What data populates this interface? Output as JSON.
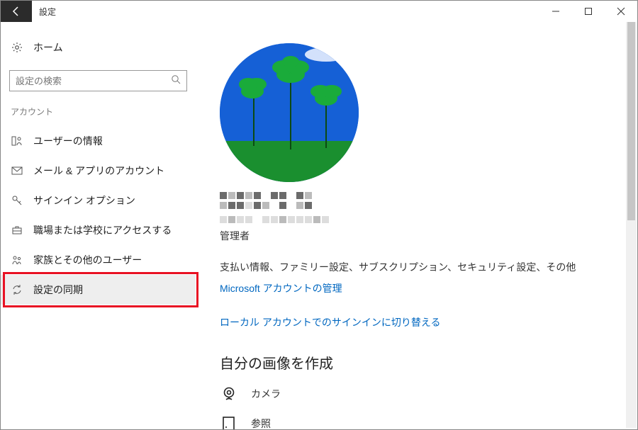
{
  "titlebar": {
    "title": "設定"
  },
  "sidebar": {
    "home": "ホーム",
    "search_placeholder": "設定の検索",
    "section": "アカウント",
    "items": [
      {
        "label": "ユーザーの情報",
        "icon": "person"
      },
      {
        "label": "メール & アプリのアカウント",
        "icon": "mail"
      },
      {
        "label": "サインイン オプション",
        "icon": "key"
      },
      {
        "label": "職場または学校にアクセスする",
        "icon": "briefcase"
      },
      {
        "label": "家族とその他のユーザー",
        "icon": "family"
      },
      {
        "label": "設定の同期",
        "icon": "sync"
      }
    ]
  },
  "content": {
    "role": "管理者",
    "desc": "支払い情報、ファミリー設定、サブスクリプション、セキュリティ設定、その他",
    "manage_link": "Microsoft アカウントの管理",
    "switch_link": "ローカル アカウントでのサインインに切り替える",
    "create_heading": "自分の画像を作成",
    "camera": "カメラ",
    "browse": "参照"
  }
}
